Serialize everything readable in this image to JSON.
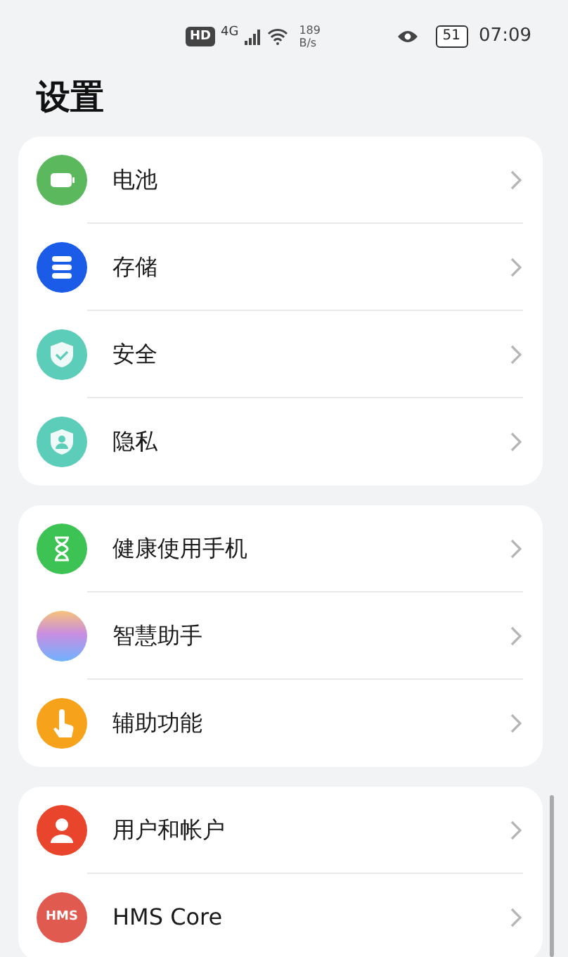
{
  "status_bar": {
    "left": [
      "HD",
      "4G"
    ],
    "speed_value": "189",
    "speed_unit": "B/s",
    "battery": "51",
    "time": "07:09"
  },
  "title": "设置",
  "groups": [
    {
      "items": [
        {
          "label": "电池",
          "kind": "battery",
          "color": "#5cb85c"
        },
        {
          "label": "存储",
          "kind": "storage",
          "color": "#1a5ce8"
        },
        {
          "label": "安全",
          "kind": "security",
          "color": "#5ccdb8"
        },
        {
          "label": "隐私",
          "kind": "privacy",
          "color": "#5ccdb8"
        }
      ]
    },
    {
      "items": [
        {
          "label": "健康使用手机",
          "kind": "hourglass",
          "color": "#3dc353"
        },
        {
          "label": "智慧助手",
          "kind": "orb",
          "color": "#c98de0"
        },
        {
          "label": "辅助功能",
          "kind": "hand",
          "color": "#f7a21b"
        }
      ]
    },
    {
      "items": [
        {
          "label": "用户和帐户",
          "kind": "user",
          "color": "#e8452c"
        },
        {
          "label": "HMS Core",
          "kind": "text",
          "color": "#e05a50",
          "icon_text": "HMS"
        }
      ]
    }
  ]
}
